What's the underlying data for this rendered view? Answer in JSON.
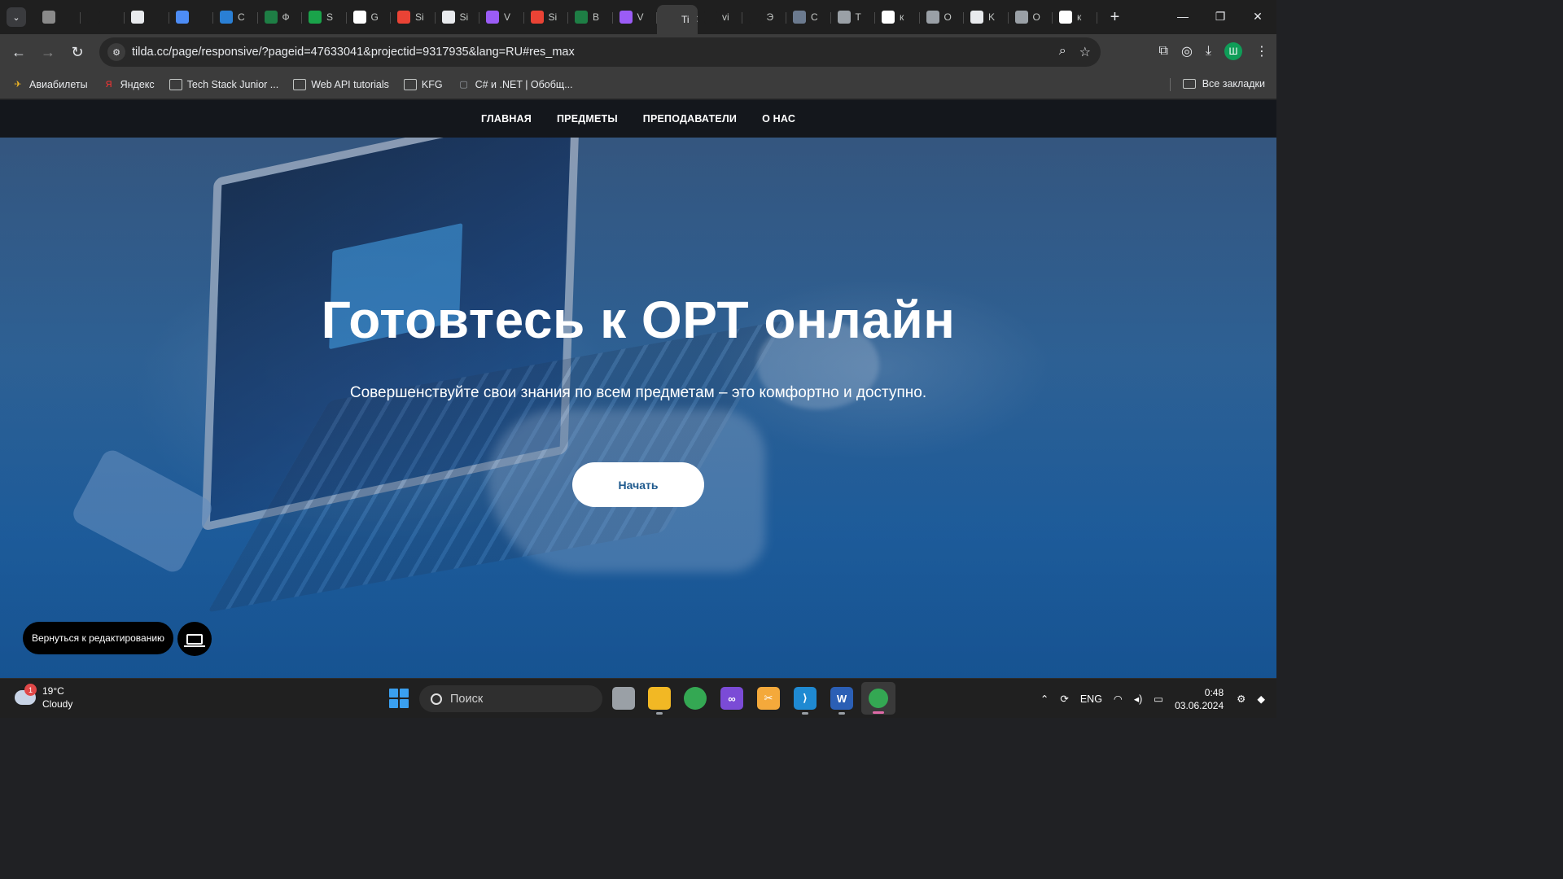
{
  "browser": {
    "tabs": [
      {
        "title": "",
        "icon": "puzzle-icon",
        "color": "#8a8a8a"
      },
      {
        "title": "",
        "icon": "dot-icon",
        "color": "#1f1f1f"
      },
      {
        "title": "",
        "icon": "openai-icon",
        "color": "#e8eaed"
      },
      {
        "title": "",
        "icon": "gemini-icon",
        "color": "#4d8cf5"
      },
      {
        "title": "C",
        "icon": "azure-icon",
        "color": "#2a7fd4"
      },
      {
        "title": "Ф",
        "icon": "excel-icon",
        "color": "#1e7e45"
      },
      {
        "title": "S",
        "icon": "globe-green-icon",
        "color": "#1aa34a"
      },
      {
        "title": "G",
        "icon": "triangle-icon",
        "color": "#ffffff"
      },
      {
        "title": "Si",
        "icon": "gmail-icon",
        "color": "#ea4335"
      },
      {
        "title": "Si",
        "icon": "doc-icon",
        "color": "#e8eaed"
      },
      {
        "title": "V",
        "icon": "vite-icon",
        "color": "#9b5cf6"
      },
      {
        "title": "Si",
        "icon": "gmail-icon",
        "color": "#ea4335"
      },
      {
        "title": "B",
        "icon": "excel-icon",
        "color": "#1e7e45"
      },
      {
        "title": "V",
        "icon": "vite-icon",
        "color": "#9b5cf6"
      },
      {
        "title": "Ti",
        "icon": "tilda-icon",
        "color": "#3c3c3c",
        "active": true
      },
      {
        "title": "vi",
        "icon": "tilda-icon",
        "color": "#1f1f1f"
      },
      {
        "title": "Э",
        "icon": "tilda-icon",
        "color": "#1f1f1f"
      },
      {
        "title": "C",
        "icon": "image-icon",
        "color": "#6b7a8f"
      },
      {
        "title": "T",
        "icon": "globe-icon",
        "color": "#9aa0a6"
      },
      {
        "title": "к",
        "icon": "google-icon",
        "color": "#ffffff"
      },
      {
        "title": "O",
        "icon": "globe-icon",
        "color": "#9aa0a6"
      },
      {
        "title": "K",
        "icon": "shield-icon",
        "color": "#e8eaed"
      },
      {
        "title": "O",
        "icon": "globe-icon",
        "color": "#9aa0a6"
      },
      {
        "title": "к",
        "icon": "google-icon",
        "color": "#ffffff"
      }
    ],
    "url": "tilda.cc/page/responsive/?pageid=47633041&projectid=9317935&lang=RU#res_max",
    "profile_letter": "Ш",
    "bookmarks": [
      {
        "label": "Авиабилеты",
        "icon": "plane-icon"
      },
      {
        "label": "Яндекс",
        "icon": "yandex-icon"
      },
      {
        "label": "Tech Stack Junior ...",
        "icon": "folder-icon"
      },
      {
        "label": "Web API tutorials",
        "icon": "folder-icon"
      },
      {
        "label": "KFG",
        "icon": "folder-icon"
      },
      {
        "label": "C# и .NET | Обобщ...",
        "icon": "page-icon"
      }
    ],
    "all_bookmarks": "Все закладки"
  },
  "site": {
    "nav": [
      "ГЛАВНАЯ",
      "ПРЕДМЕТЫ",
      "ПРЕПОДАВАТЕЛИ",
      "О НАС"
    ],
    "hero_title": "Готовтесь к ОРТ онлайн",
    "hero_subtitle": "Совершенствуйте свои знания по всем предметам – это комфортно и доступно.",
    "cta_label": "Начать",
    "edit_label": "Вернуться к редактированию",
    "accent_color": "#1f5a8e"
  },
  "taskbar": {
    "weather_temp": "19°C",
    "weather_desc": "Cloudy",
    "weather_badge": "1",
    "search_placeholder": "Поиск",
    "language": "ENG",
    "time": "0:48",
    "date": "03.06.2024"
  }
}
